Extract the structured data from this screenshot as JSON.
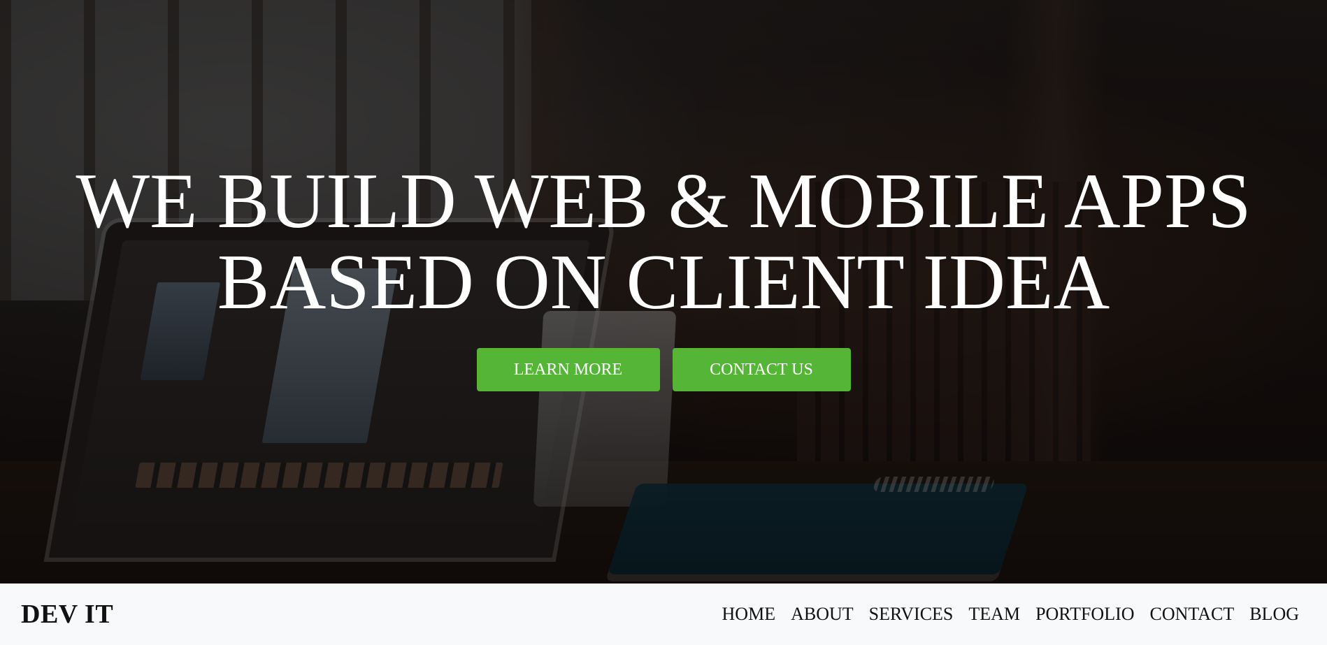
{
  "hero": {
    "title_line_1": "WE BUILD WEB & MOBILE APPS",
    "title_line_2": "BASED ON CLIENT IDEA",
    "buttons": [
      {
        "label": "LEARN MORE"
      },
      {
        "label": "CONTACT US"
      }
    ]
  },
  "navbar": {
    "brand": "DEV IT",
    "links": [
      {
        "label": "HOME"
      },
      {
        "label": "ABOUT"
      },
      {
        "label": "SERVICES"
      },
      {
        "label": "TEAM"
      },
      {
        "label": "PORTFOLIO"
      },
      {
        "label": "CONTACT"
      },
      {
        "label": "BLOG"
      }
    ]
  },
  "colors": {
    "accent": "#55b536",
    "nav_background": "#f8f9fa",
    "hero_overlay": "rgba(0,0,0,0.50)"
  }
}
